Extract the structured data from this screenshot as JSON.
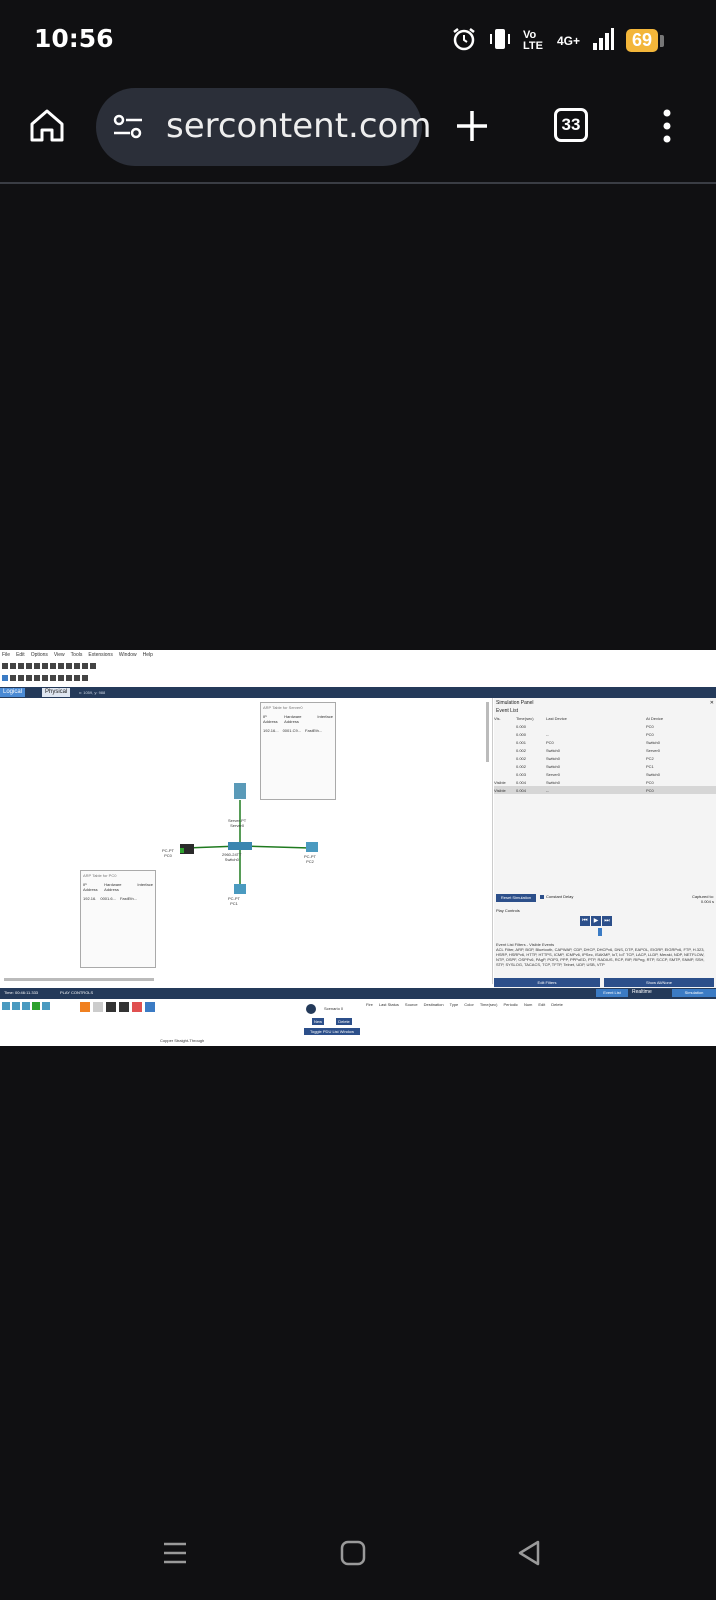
{
  "status_bar": {
    "time": "10:56",
    "network": "4G+",
    "volte": "Vo LTE",
    "battery": "69"
  },
  "browser": {
    "url": "sercontent.com",
    "tab_count": "33"
  },
  "app": {
    "menu": [
      "File",
      "Edit",
      "Options",
      "View",
      "Tools",
      "Extensions",
      "Window",
      "Help"
    ],
    "tabs": {
      "logical": "Logical",
      "physical": "Physical",
      "coords": "x: 1059, y: 988"
    },
    "popups": {
      "server": {
        "title": "ARP Table for Server0",
        "headers": [
          "IP Address",
          "Hardware Address",
          "Interface"
        ],
        "row": [
          "192.16...",
          "0001.C9...",
          "FastEth..."
        ]
      },
      "pc": {
        "title": "ARP Table for PC0",
        "headers": [
          "IP Address",
          "Hardware Address",
          "Interface"
        ],
        "row": [
          "192.16.",
          "0001.6...",
          "FastEth..."
        ]
      }
    },
    "devices": {
      "server": "Server-PT\nServer0",
      "switch": "2960-24TT\nSwitch0",
      "pc0": "PC-PT\nPC0",
      "pc1": "PC-PT\nPC1",
      "pc2": "PC-PT\nPC2"
    },
    "sim": {
      "title": "Simulation Panel",
      "event_list": "Event List",
      "headers": [
        "Vis.",
        "Time(sec)",
        "Last Device",
        "At Device"
      ],
      "rows": [
        [
          "",
          "0.000",
          "",
          "PC0"
        ],
        [
          "",
          "0.000",
          "--",
          "PC0"
        ],
        [
          "",
          "0.001",
          "PC0",
          "Switch0"
        ],
        [
          "",
          "0.002",
          "Switch0",
          "Server0"
        ],
        [
          "",
          "0.002",
          "Switch0",
          "PC2"
        ],
        [
          "",
          "0.002",
          "Switch0",
          "PC1"
        ],
        [
          "",
          "0.003",
          "Server0",
          "Switch0"
        ],
        [
          "Visible",
          "0.004",
          "Switch0",
          "PC0"
        ],
        [
          "Visible",
          "0.004",
          "--",
          "PC0"
        ]
      ],
      "reset": "Reset Simulation",
      "constant_delay": "Constant Delay",
      "captured_to": "Captured to:",
      "captured_val": "0.004 s",
      "play_controls": "Play Controls",
      "filters_title": "Event List Filters - Visible Events",
      "filters_text": "ACL Filter, ARP, BGP, Bluetooth, CAPWAP, CDP, DHCP, DHCPv6, DNS, DTP, EAPOL, EIGRP, EIGRPv6, FTP, H.323, HSRP, HSRPv6, HTTP, HTTPS, ICMP, ICMPv6, IPSec, ISAKMP, IoT, IoT TCP, LACP, LLDP, Meraki, NDP, NETFLOW, NTP, OSPF, OSPFv6, PAgP, POP3, PPP, PPPoED, PTP, RADIUS, RCP, RIP, RIPng, RTP, SCCP, SMTP, SNMP, SSH, STP, SYSLOG, TACACS, TCP, TFTP, Telnet, UDP, USB, VTP",
      "edit_filters": "Edit Filters",
      "show_all": "Show All/None"
    },
    "bottom": {
      "time": "Time: 00:46:11.333",
      "play_controls": "PLAY CONTROLS",
      "realtime": "Realtime",
      "simulation": "Simulation",
      "event_list_btn": "Event List",
      "cable_label": "Copper Straight-Through",
      "scenario": "Scenario 0",
      "new": "New",
      "delete": "Delete",
      "toggle": "Toggle PDU List Window",
      "pdu_headers": [
        "Fire",
        "Last Status",
        "Source",
        "Destination",
        "Type",
        "Color",
        "Time(sec)",
        "Periodic",
        "Num",
        "Edit",
        "Delete"
      ]
    }
  },
  "colors": {
    "background": "#101012",
    "urlbar": "#2b2f39",
    "battery": "#f3b63a",
    "app_bar": "#243a5a"
  }
}
